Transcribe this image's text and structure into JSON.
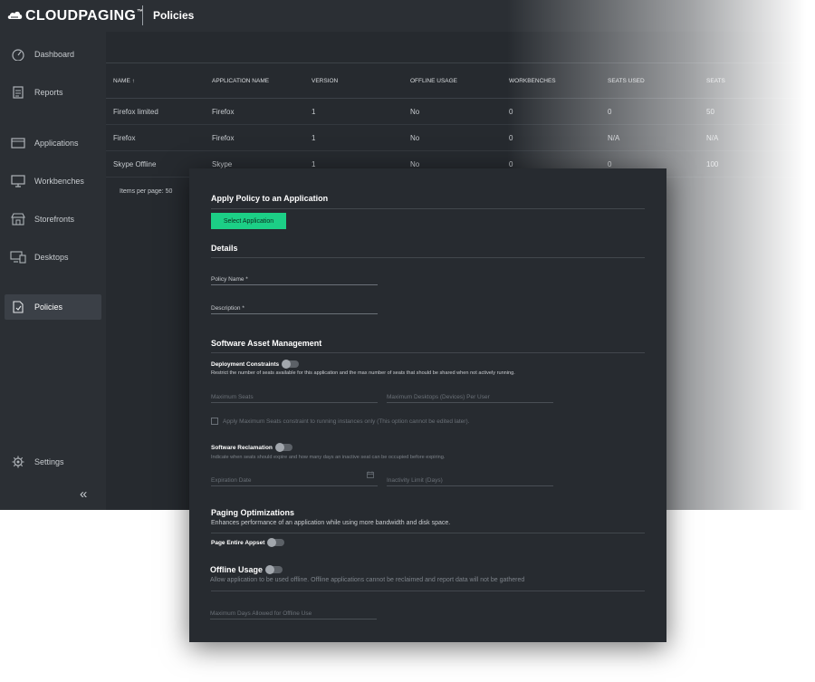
{
  "brand": {
    "name": "CLOUDPAGING",
    "trademark": "™"
  },
  "page_title": "Policies",
  "sidebar": {
    "items": [
      {
        "label": "Dashboard",
        "icon": "gauge-icon"
      },
      {
        "label": "Reports",
        "icon": "document-icon"
      },
      {
        "label": "Applications",
        "icon": "window-icon"
      },
      {
        "label": "Workbenches",
        "icon": "monitor-icon"
      },
      {
        "label": "Storefronts",
        "icon": "storefront-icon"
      },
      {
        "label": "Desktops",
        "icon": "desktops-icon"
      },
      {
        "label": "Policies",
        "icon": "policies-icon",
        "active": true
      }
    ],
    "settings_label": "Settings",
    "collapse_glyph": "«"
  },
  "table": {
    "headers": [
      "NAME ↑",
      "APPLICATION NAME",
      "VERSION",
      "OFFLINE USAGE",
      "WORKBENCHES",
      "SEATS USED",
      "SEATS"
    ],
    "rows": [
      [
        "Firefox limited",
        "Firefox",
        "1",
        "No",
        "0",
        "0",
        "50"
      ],
      [
        "Firefox",
        "Firefox",
        "1",
        "No",
        "0",
        "N/A",
        "N/A"
      ],
      [
        "Skype Offline",
        "Skype",
        "1",
        "No",
        "0",
        "0",
        "100"
      ]
    ],
    "items_per_page": "Items per page: 50"
  },
  "modal": {
    "title": "Apply Policy to an Application",
    "select_button": "Select Application",
    "details_heading": "Details",
    "policy_name_label": "Policy Name *",
    "description_label": "Description *",
    "sam_heading": "Software Asset Management",
    "deployment_label": "Deployment Constraints",
    "deployment_desc": "Restrict the number of seats available for this application and the max number of seats that should be shared when not actively running.",
    "max_seats_label": "Maximum Seats",
    "max_desktops_label": "Maximum Desktops (Devices) Per User",
    "apply_checkbox_label": "Apply Maximum Seats constraint to running instances only (This option cannot be edited later).",
    "reclamation_label": "Software Reclamation",
    "reclamation_desc": "Indicate when seats should expire and how many days an inactive seat can be occupied before expiring.",
    "expiration_label": "Expiration Date",
    "inactivity_label": "Inactivity Limit (Days)",
    "paging_heading": "Paging Optimizations",
    "paging_desc": "Enhances performance of an application while using more bandwidth and disk space.",
    "page_entire_label": "Page Entire Appset",
    "offline_label": "Offline Usage",
    "offline_desc": "Allow application to be used offline. Offline applications cannot be reclaimed and report data will not be gathered",
    "max_days_label": "Maximum Days Allowed for Offline Use"
  },
  "colors": {
    "accent": "#1ccf86",
    "background": "#262a2f",
    "sidebar": "#2b2f34"
  }
}
